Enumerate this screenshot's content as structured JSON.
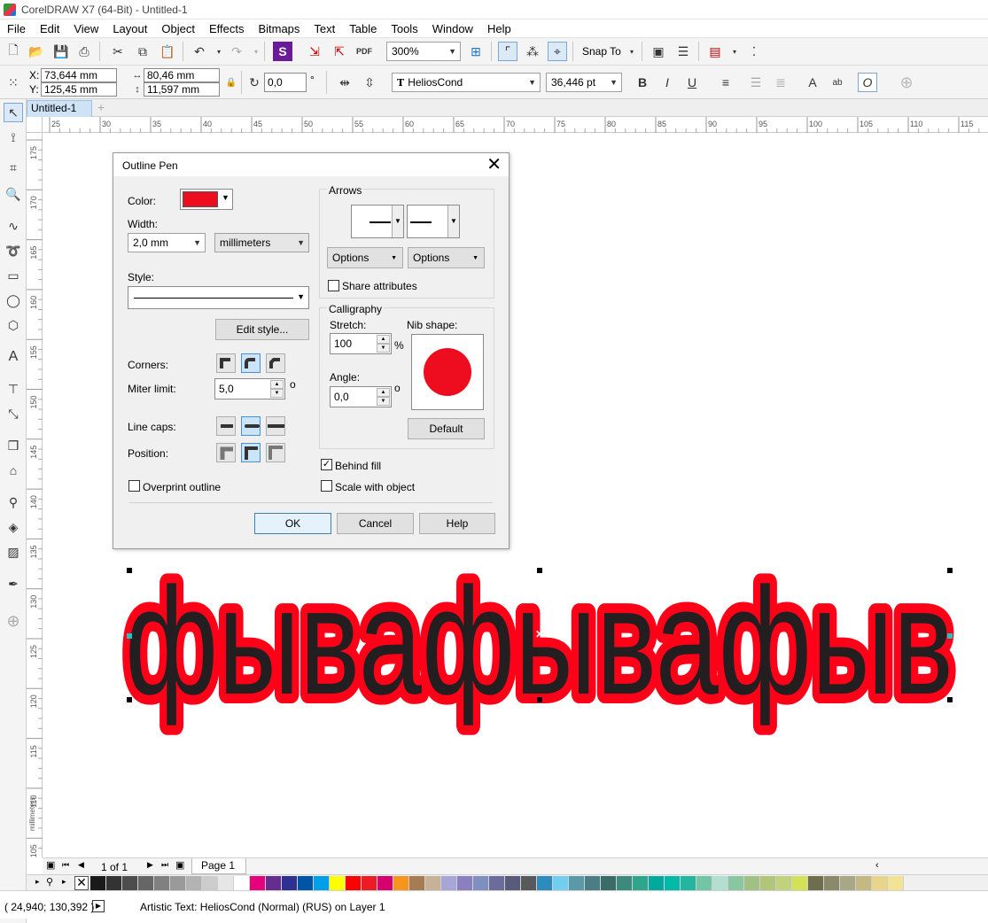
{
  "app": {
    "title": "CorelDRAW X7 (64-Bit) - Untitled-1"
  },
  "menu": [
    "File",
    "Edit",
    "View",
    "Layout",
    "Object",
    "Effects",
    "Bitmaps",
    "Text",
    "Table",
    "Tools",
    "Window",
    "Help"
  ],
  "toolbar1": {
    "zoom": "300%",
    "snap_label": "Snap To"
  },
  "propbar": {
    "x_label": "X:",
    "x_value": "73,644 mm",
    "y_label": "Y:",
    "y_value": "125,45 mm",
    "w_value": "80,46 mm",
    "h_value": "11,597 mm",
    "angle_value": "0,0",
    "degree": "°",
    "font_name": "HeliosCond",
    "font_size": "36,446 pt"
  },
  "doc_tab": "Untitled-1",
  "ruler": {
    "h_ticks": [
      "25",
      "30",
      "35",
      "40",
      "45",
      "50",
      "55",
      "60",
      "65",
      "70",
      "75",
      "80",
      "85",
      "90",
      "95",
      "100",
      "105",
      "110",
      "115"
    ],
    "v_ticks": [
      "175",
      "170",
      "165",
      "160",
      "155",
      "150",
      "145",
      "140",
      "135",
      "130",
      "125",
      "120",
      "115",
      "110",
      "105"
    ],
    "units": "millimeters"
  },
  "canvas": {
    "text": "фывафывафыв",
    "fill_color": "#231f20",
    "outline_color": "#ff0019"
  },
  "dialog": {
    "title": "Outline Pen",
    "color_label": "Color:",
    "color_value": "#ee0d1f",
    "width_label": "Width:",
    "width_value": "2,0 mm",
    "units_value": "millimeters",
    "style_label": "Style:",
    "edit_style": "Edit style...",
    "corners_label": "Corners:",
    "miter_label": "Miter limit:",
    "miter_value": "5,0",
    "degree": "o",
    "linecaps_label": "Line caps:",
    "position_label": "Position:",
    "overprint_label": "Overprint outline",
    "arrows_label": "Arrows",
    "options1": "Options",
    "options2": "Options",
    "share_label": "Share attributes",
    "calligraphy_label": "Calligraphy",
    "stretch_label": "Stretch:",
    "stretch_value": "100",
    "percent": "%",
    "nib_label": "Nib shape:",
    "angle_label": "Angle:",
    "angle_value": "0,0",
    "default_btn": "Default",
    "behind_fill": "Behind fill",
    "behind_fill_checked": true,
    "scale_with_object": "Scale with object",
    "ok": "OK",
    "cancel": "Cancel",
    "help": "Help"
  },
  "pagebar": {
    "page_count": "1 of 1",
    "page_tab": "Page 1"
  },
  "palette_colors": [
    "#1a1a1a",
    "#333333",
    "#4d4d4d",
    "#666666",
    "#808080",
    "#999999",
    "#b3b3b3",
    "#cccccc",
    "#e6e6e6",
    "#ffffff",
    "#e6007e",
    "#662d91",
    "#2e3192",
    "#0054a6",
    "#00a0e9",
    "#ffff00",
    "#ff0000",
    "#ed1c24",
    "#d6006f",
    "#f7941d",
    "#a67c52",
    "#c7b299",
    "#a6a6d9",
    "#8c7fc0",
    "#7f8fbf",
    "#6c6c9c",
    "#595b7a",
    "#58595b",
    "#2e8bc0",
    "#73cdf0",
    "#5a9aa8",
    "#4b7d84",
    "#3a6b66",
    "#3b8a7d",
    "#2fa58e",
    "#00a99d",
    "#00b9a8",
    "#24b5a0",
    "#72c6a6",
    "#b2dfcf",
    "#8ac6a0",
    "#a0c183",
    "#b2c67a",
    "#c0d27b",
    "#d4e157",
    "#6e6e4e",
    "#8a8a6a",
    "#a9a886",
    "#c4b980",
    "#e6d58b",
    "#f2e394"
  ],
  "status": {
    "coords": "( 24,940; 130,392 )",
    "info": "Artistic Text: HeliosCond (Normal) (RUS) on Layer 1"
  }
}
